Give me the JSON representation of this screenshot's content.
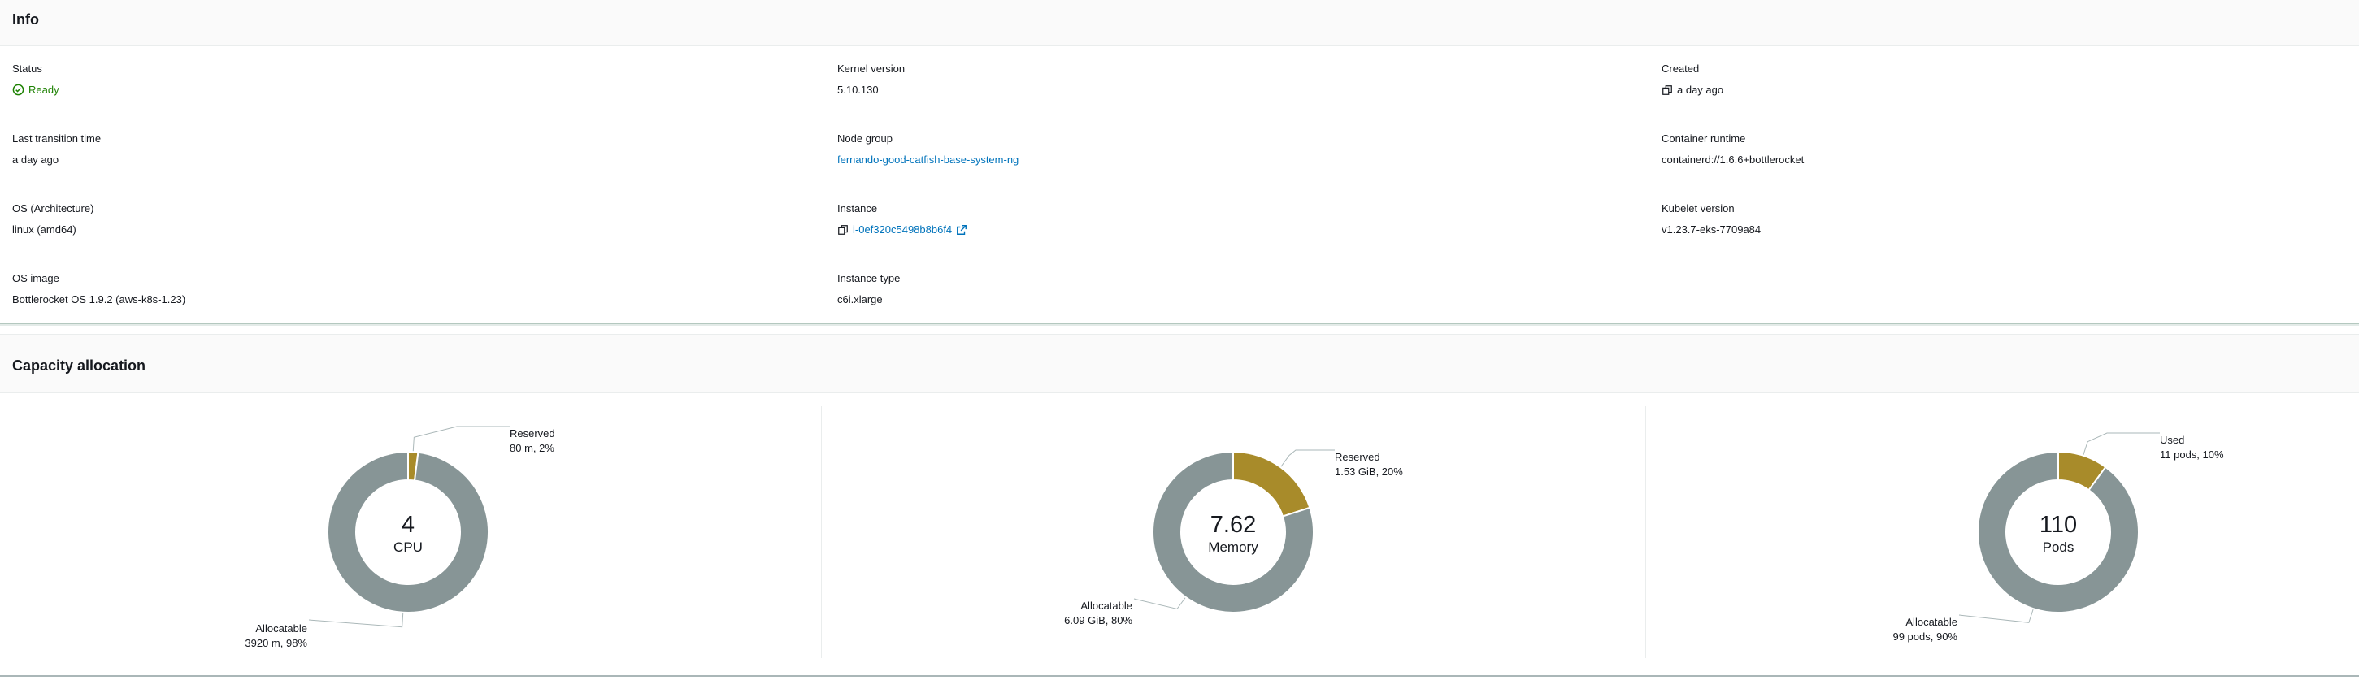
{
  "info": {
    "title": "Info",
    "fields": {
      "status": {
        "label": "Status",
        "value": "Ready"
      },
      "kernel_version": {
        "label": "Kernel version",
        "value": "5.10.130"
      },
      "created": {
        "label": "Created",
        "value": "a day ago"
      },
      "last_transition": {
        "label": "Last transition time",
        "value": "a day ago"
      },
      "node_group": {
        "label": "Node group",
        "value": "fernando-good-catfish-base-system-ng"
      },
      "container_runtime": {
        "label": "Container runtime",
        "value": "containerd://1.6.6+bottlerocket"
      },
      "os_arch": {
        "label": "OS (Architecture)",
        "value": "linux (amd64)"
      },
      "instance": {
        "label": "Instance",
        "value": "i-0ef320c5498b8b6f4"
      },
      "kubelet_version": {
        "label": "Kubelet version",
        "value": "v1.23.7-eks-7709a84"
      },
      "os_image": {
        "label": "OS image",
        "value": "Bottlerocket OS 1.9.2 (aws-k8s-1.23)"
      },
      "instance_type": {
        "label": "Instance type",
        "value": "c6i.xlarge"
      }
    }
  },
  "capacity": {
    "title": "Capacity allocation",
    "cpu": {
      "total": "4",
      "unit": "CPU",
      "reserved_title": "Reserved",
      "reserved_detail": "80 m, 2%",
      "alloc_title": "Allocatable",
      "alloc_detail": "3920 m, 98%"
    },
    "memory": {
      "total": "7.62",
      "unit": "Memory",
      "reserved_title": "Reserved",
      "reserved_detail": "1.53 GiB, 20%",
      "alloc_title": "Allocatable",
      "alloc_detail": "6.09 GiB, 80%"
    },
    "pods": {
      "total": "110",
      "unit": "Pods",
      "reserved_title": "Used",
      "reserved_detail": "11 pods, 10%",
      "alloc_title": "Allocatable",
      "alloc_detail": "99 pods, 90%"
    }
  },
  "chart_data": [
    {
      "type": "pie",
      "categories": [
        "Reserved",
        "Allocatable"
      ],
      "values": [
        80,
        3920
      ],
      "percent": [
        2,
        98
      ],
      "center_value": "4",
      "center_label": "CPU"
    },
    {
      "type": "pie",
      "categories": [
        "Reserved",
        "Allocatable"
      ],
      "values": [
        1.53,
        6.09
      ],
      "percent": [
        20,
        80
      ],
      "center_value": "7.62",
      "center_label": "Memory"
    },
    {
      "type": "pie",
      "categories": [
        "Used",
        "Allocatable"
      ],
      "values": [
        11,
        99
      ],
      "percent": [
        10,
        90
      ],
      "center_value": "110",
      "center_label": "Pods"
    }
  ],
  "colors": {
    "reserved": "#a88b2a",
    "allocatable": "#879596",
    "link": "#0073bb",
    "ok": "#1d8102"
  }
}
